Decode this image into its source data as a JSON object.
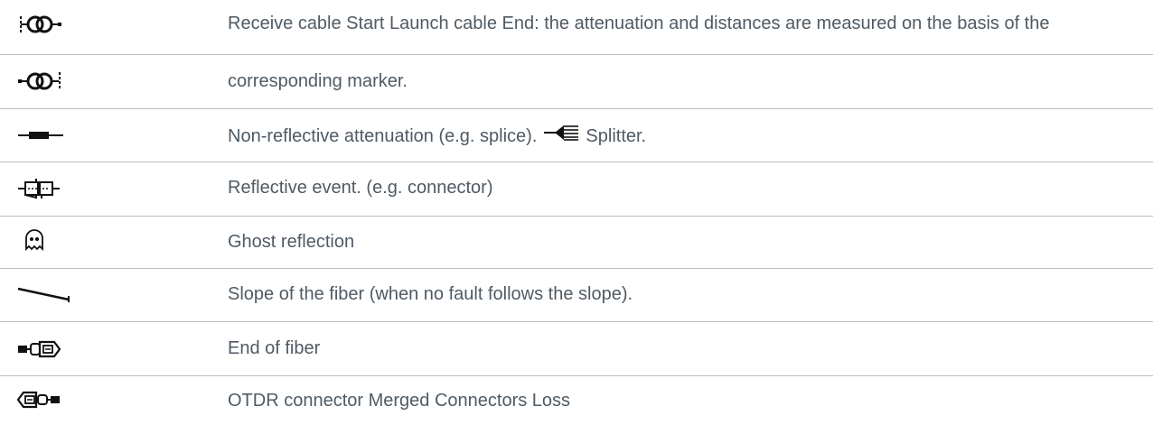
{
  "rows": [
    {
      "icon": "receive-cable-start-icon",
      "text": "Receive cable Start Launch cable End: the attenuation and distances are measured on the basis of the"
    },
    {
      "icon": "launch-cable-end-icon",
      "text": "corresponding marker."
    },
    {
      "icon": "non-reflective-attenuation-icon",
      "text": "Non-reflective attenuation (e.g. splice).",
      "text_after": "Splitter.",
      "inline_icon": "splitter-icon"
    },
    {
      "icon": "reflective-event-icon",
      "text": "Reflective event. (e.g. connector)"
    },
    {
      "icon": "ghost-reflection-icon",
      "text": "Ghost reflection"
    },
    {
      "icon": "fiber-slope-icon",
      "text": "Slope of the fiber (when no fault follows the slope)."
    },
    {
      "icon": "end-of-fiber-icon",
      "text": "End of fiber"
    },
    {
      "icon": "otdr-connector-icon",
      "text": "OTDR connector Merged Connectors Loss"
    }
  ],
  "colors": {
    "text": "#4f5a64",
    "separator": "#b8bec4",
    "icon": "#111111"
  }
}
